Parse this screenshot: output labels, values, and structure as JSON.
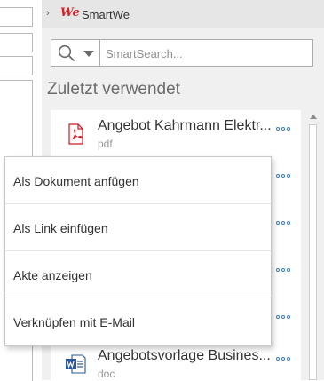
{
  "header": {
    "logo_text": "We",
    "title": "SmartWe"
  },
  "search": {
    "placeholder": "SmartSearch..."
  },
  "section_title": "Zuletzt verwendet",
  "items": [
    {
      "title": "Angebot Kahrmann Elektr...",
      "type": "pdf",
      "icon": "pdf-icon"
    },
    {
      "title": "",
      "type": "",
      "icon": ""
    },
    {
      "title": "",
      "type": "",
      "icon": ""
    },
    {
      "title": "",
      "type": "",
      "icon": ""
    },
    {
      "title": "",
      "type": "",
      "icon": ""
    },
    {
      "title": "Angebotsvorlage Busines...",
      "type": "doc",
      "icon": "word-document-icon"
    }
  ],
  "context_menu": {
    "items": [
      {
        "label": "Als Dokument anfügen"
      },
      {
        "label": "Als Link einfügen"
      },
      {
        "label": "Akte anzeigen"
      },
      {
        "label": "Verknüpfen mit E-Mail"
      }
    ]
  },
  "colors": {
    "accent": "#3b7fc4",
    "pdf_red": "#c81a21",
    "word_blue": "#2b579a",
    "logo_red": "#d2232a"
  }
}
